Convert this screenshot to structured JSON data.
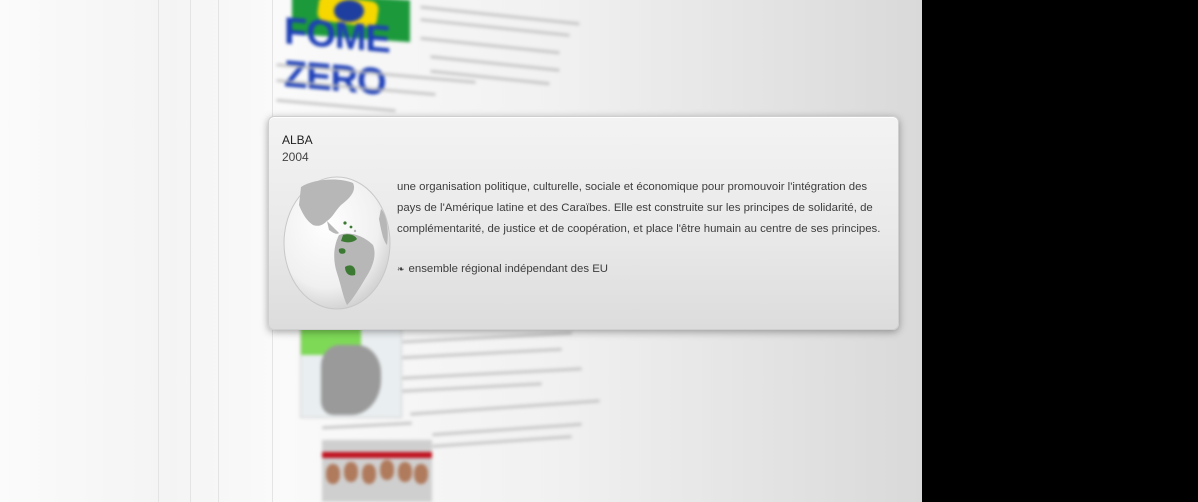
{
  "background_page": {
    "logo_text": "FOME ZERO"
  },
  "card": {
    "title": "ALBA",
    "year": "2004",
    "description": "une organisation politique, culturelle, sociale et économique pour promouvoir l'intégration des pays de l'Amérique latine et des Caraïbes. Elle est construite sur les principes de solidarité, de complémentarité, de justice et de coopération, et place l'être humain au centre de ses principes.",
    "note": "ensemble régional indépendant des EU",
    "note_icon": "bullet-icon",
    "globe_icon": "globe-map-icon"
  },
  "colors": {
    "member_green": "#3c7a33",
    "ocean": "#f4f4f4",
    "land": "#b3b3b3",
    "side_black": "#000000"
  }
}
